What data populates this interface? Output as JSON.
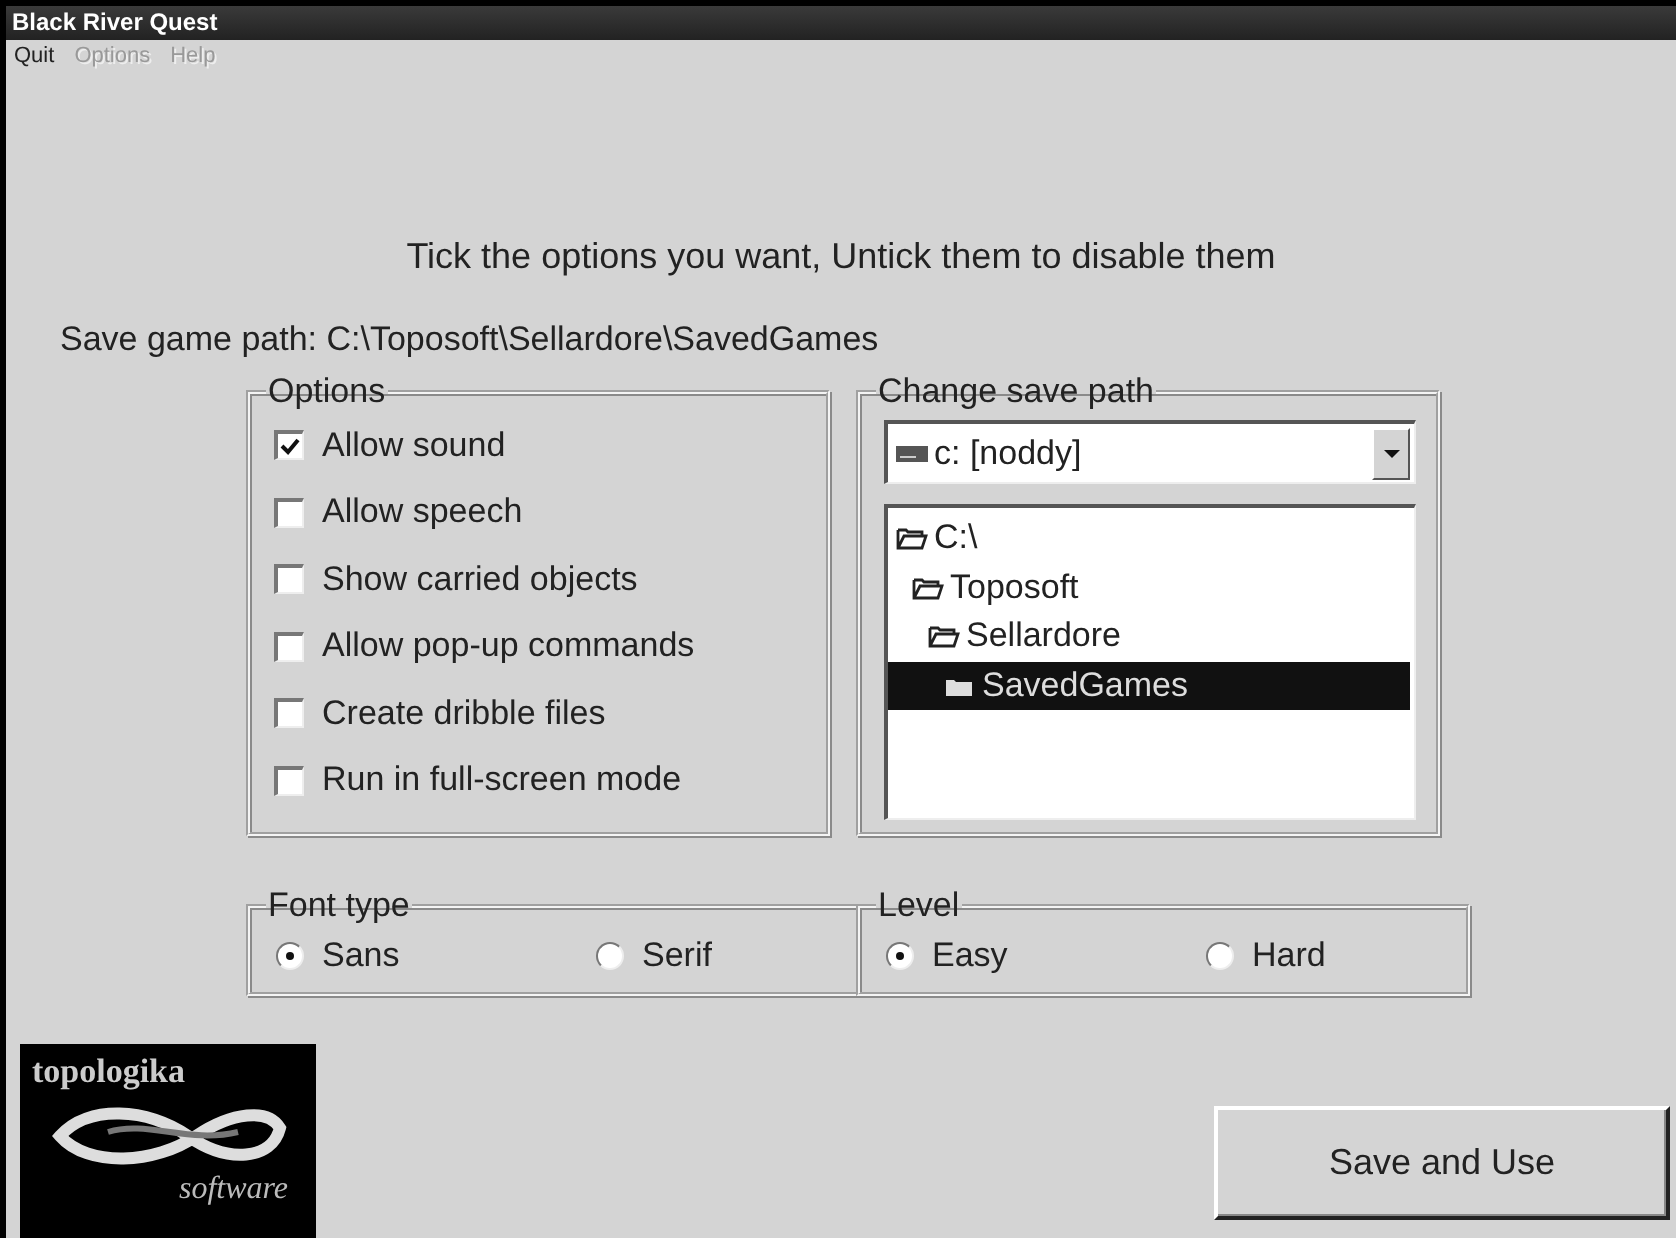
{
  "window": {
    "title": "Black River Quest"
  },
  "menu": [
    {
      "label": "Quit",
      "disabled": false
    },
    {
      "label": "Options",
      "disabled": true
    },
    {
      "label": "Help",
      "disabled": true
    }
  ],
  "instruction": "Tick the options you want, Untick them to disable them",
  "save_path": "Save game path: C:\\Toposoft\\Sellardore\\SavedGames",
  "options": {
    "title": "Options",
    "items": [
      {
        "label": "Allow sound",
        "checked": true
      },
      {
        "label": "Allow speech",
        "checked": false
      },
      {
        "label": "Show carried objects",
        "checked": false
      },
      {
        "label": "Allow pop-up commands",
        "checked": false
      },
      {
        "label": "Create dribble files",
        "checked": false
      },
      {
        "label": "Run in full-screen mode",
        "checked": false
      }
    ]
  },
  "change_save_path": {
    "title": "Change save path",
    "drive": "c: [noddy]",
    "folders": [
      {
        "label": "C:\\",
        "selected": false,
        "children": [
          {
            "label": "Toposoft",
            "selected": false,
            "children": [
              {
                "label": "Sellardore",
                "selected": false,
                "children": [
                  {
                    "label": "SavedGames",
                    "selected": true
                  }
                ]
              }
            ]
          }
        ]
      }
    ]
  },
  "font_type": {
    "title": "Font type",
    "choices": [
      {
        "label": "Sans",
        "selected": true
      },
      {
        "label": "Serif",
        "selected": false
      }
    ]
  },
  "level": {
    "title": "Level",
    "choices": [
      {
        "label": "Easy",
        "selected": true
      },
      {
        "label": "Hard",
        "selected": false
      }
    ]
  },
  "logo": {
    "wordmark": "topologika",
    "tagline": "software"
  },
  "buttons": [
    "Save and Use"
  ]
}
